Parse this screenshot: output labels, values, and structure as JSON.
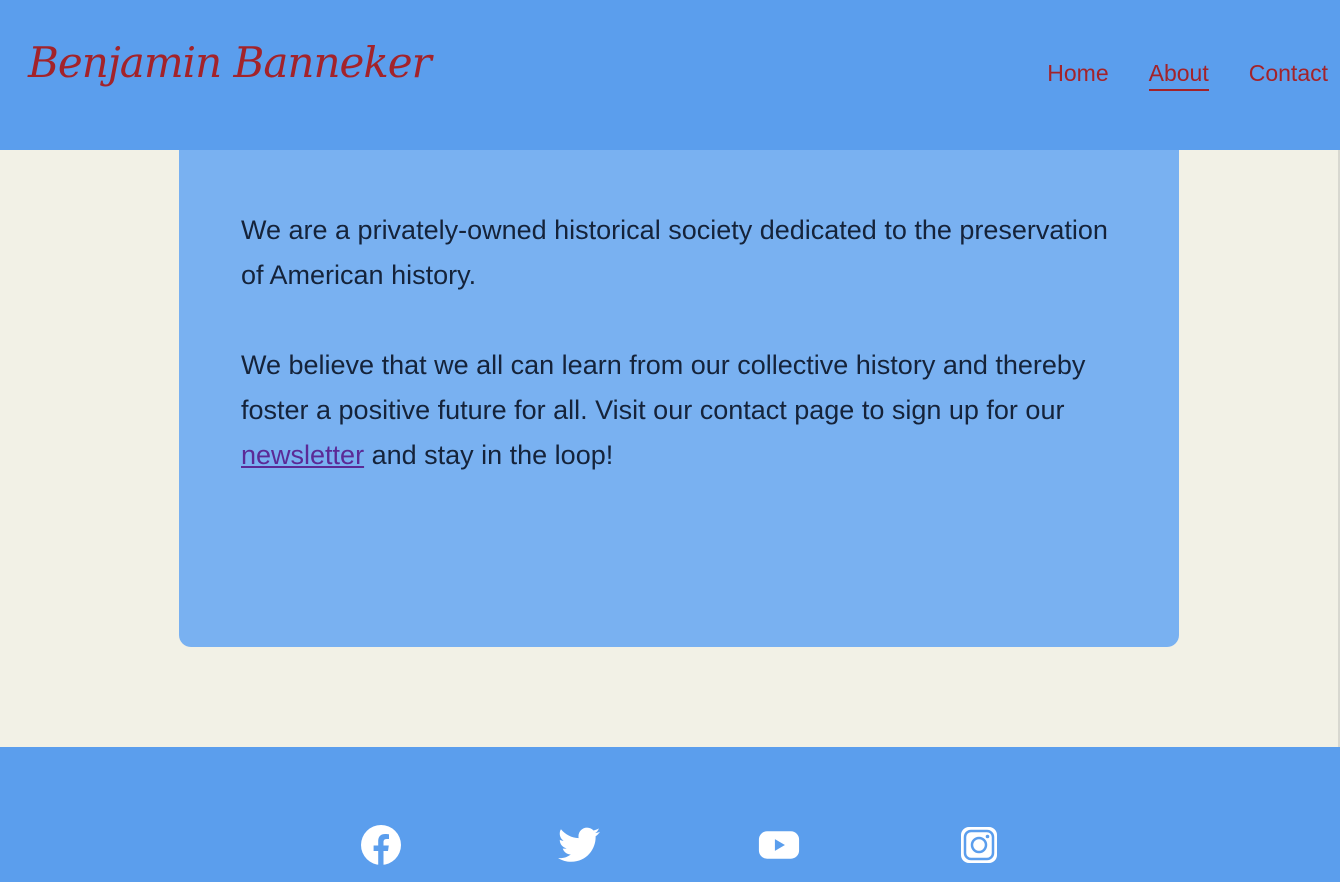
{
  "header": {
    "logo": "Benjamin Banneker",
    "nav": [
      {
        "label": "Home"
      },
      {
        "label": "About"
      },
      {
        "label": "Contact"
      }
    ],
    "active_nav": "About"
  },
  "content": {
    "paragraph_1": "We are a privately-owned historical society dedicated to the preservation of American history.",
    "paragraph_2_before": "We believe that we all can learn from our collective history and thereby foster a positive future for all. Visit our contact page to sign up for our ",
    "paragraph_2_link": "newsletter",
    "paragraph_2_after": " and stay in the loop!"
  },
  "footer": {
    "social_icons": [
      "facebook-icon",
      "twitter-icon",
      "youtube-icon",
      "instagram-icon"
    ]
  },
  "colors": {
    "header_bg": "#5b9eed",
    "page_bg": "#f2f1e6",
    "card_bg": "#79b1f1",
    "accent": "#a3232a",
    "link": "#5b2a96"
  }
}
